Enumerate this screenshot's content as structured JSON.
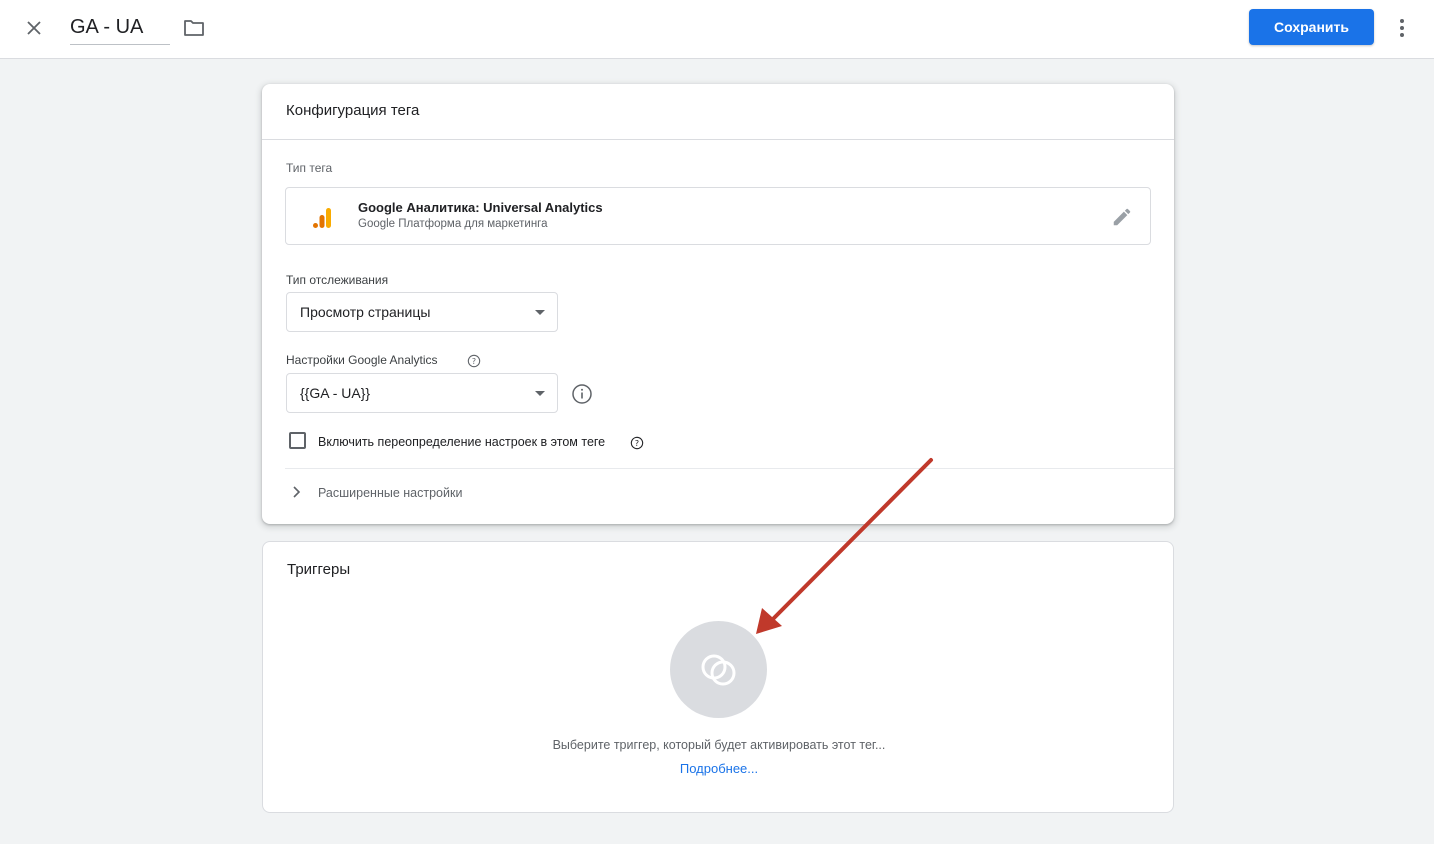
{
  "topbar": {
    "tag_name": "GA - UA",
    "save_label": "Сохранить",
    "icons": [
      "close-icon",
      "folder-icon",
      "more-vert-icon"
    ]
  },
  "config_card": {
    "title": "Конфигурация тега",
    "tag_type_label": "Тип тега",
    "tag_type": {
      "name": "Google Аналитика: Universal Analytics",
      "subtitle": "Google Платформа для маркетинга",
      "icon": "google-analytics-icon",
      "icon_colors": [
        "#f9ab00",
        "#e37400"
      ]
    },
    "tracking_type_label": "Тип отслеживания",
    "tracking_type_value": "Просмотр страницы",
    "ga_settings_label": "Настройки Google Analytics",
    "ga_settings_value": "{{GA - UA}}",
    "override_checkbox": {
      "label": "Включить переопределение настроек в этом теге",
      "checked": false
    },
    "advanced_label": "Расширенные настройки"
  },
  "triggers_card": {
    "title": "Триггеры",
    "hint": "Выберите триггер, который будет активировать этот тег...",
    "link": "Подробнее..."
  },
  "colors": {
    "accent": "#1a73e8",
    "annotation_arrow": "#c0392b"
  }
}
